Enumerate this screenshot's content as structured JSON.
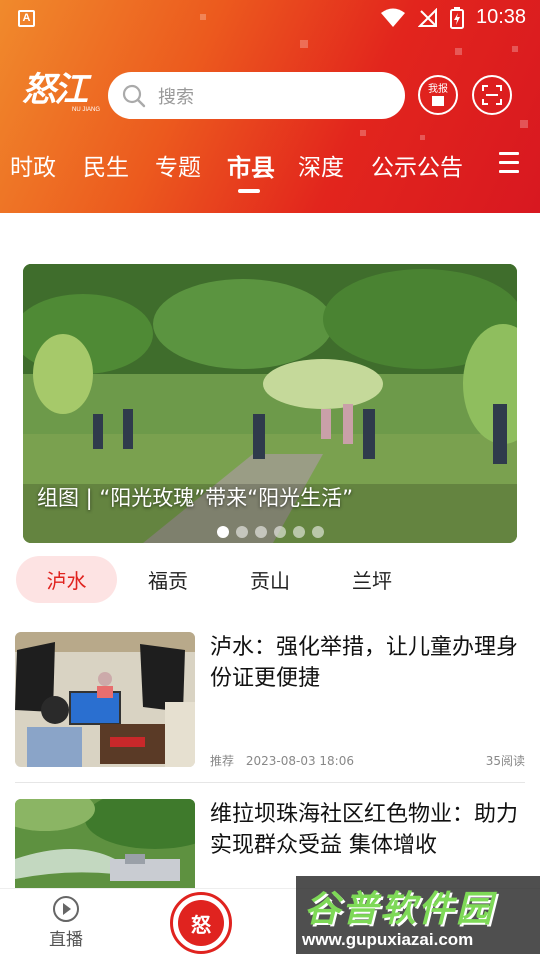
{
  "status_bar": {
    "app_indicator": "A",
    "time": "10:38"
  },
  "header": {
    "logo_text": "怒江",
    "logo_subtext": "NU JIANG",
    "search_placeholder": "搜索",
    "report_button_label": "我报",
    "colors": {
      "gradient_start": "#f08a2c",
      "gradient_end": "#d81820"
    }
  },
  "nav": {
    "items": [
      {
        "label": "时政"
      },
      {
        "label": "民生"
      },
      {
        "label": "专题"
      },
      {
        "label": "市县",
        "active": true
      },
      {
        "label": "深度"
      },
      {
        "label": "公示公告"
      }
    ],
    "menu_icon": "menu-icon"
  },
  "banner": {
    "caption": "组图 | “阳光玫瑰”带来“阳光生活”",
    "dot_count": 6,
    "active_dot": 0
  },
  "county_tabs": [
    {
      "label": "泸水",
      "active": true
    },
    {
      "label": "福贡"
    },
    {
      "label": "贡山"
    },
    {
      "label": "兰坪"
    }
  ],
  "news": [
    {
      "title": "泸水：强化举措，让儿童办理身份证更便捷",
      "tag": "推荐",
      "datetime": "2023-08-03 18:06",
      "reads": "35阅读"
    },
    {
      "title": "维拉坝珠海社区红色物业：助力实现群众受益 集体增收"
    }
  ],
  "tabbar": {
    "items": [
      {
        "label": "直播",
        "icon": "play-icon"
      }
    ],
    "center_icon_text": "怒"
  },
  "watermark": {
    "main": "谷普软件园",
    "sub": "www.gupuxiazai.com"
  },
  "accent_color": "#e0231f"
}
